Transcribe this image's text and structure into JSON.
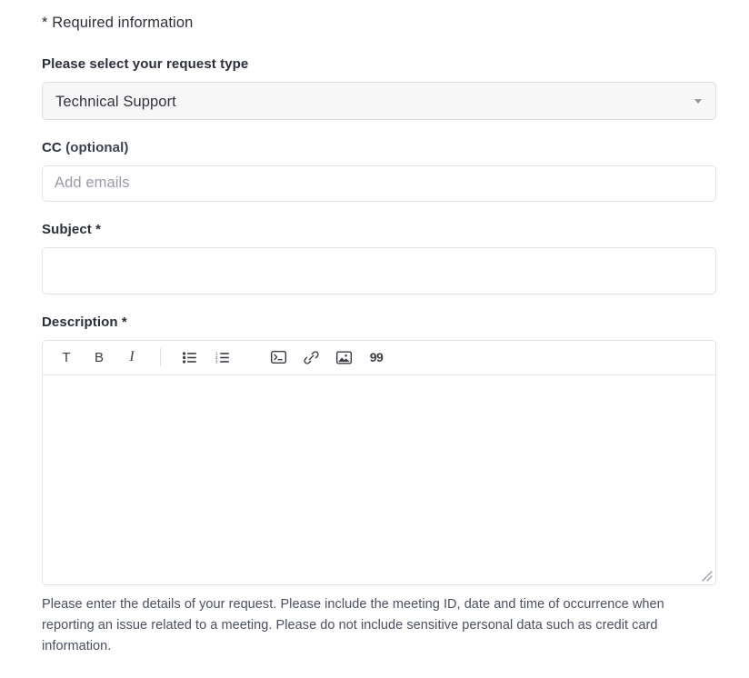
{
  "form": {
    "required_note": "* Required information",
    "request_type": {
      "label": "Please select your request type",
      "selected_value": "Technical Support",
      "caret_icon": "chevron-down-icon"
    },
    "cc": {
      "label_main": "CC ",
      "label_optional": "(optional)",
      "placeholder": "Add emails",
      "value": ""
    },
    "subject": {
      "label_main": "Subject ",
      "required_marker": "*",
      "placeholder": "",
      "value": ""
    },
    "description": {
      "label_main": "Description ",
      "required_marker": "*",
      "value": "",
      "placeholder": "",
      "helper_text": "Please enter the details of your request. Please include the meeting ID, date and time of occurrence when reporting an issue related to a meeting. Please do not include sensitive personal data such as credit card information.",
      "resize_handle_icon": "resize-grip-icon",
      "toolbar": [
        {
          "name": "text-style-button",
          "icon": "text-format-icon",
          "glyph": "T",
          "style": "plain"
        },
        {
          "name": "bold-button",
          "icon": "bold-icon",
          "glyph": "B",
          "style": "plain"
        },
        {
          "name": "italic-button",
          "icon": "italic-icon",
          "glyph": "I",
          "style": "italic"
        },
        {
          "name": "bulleted-list-button",
          "icon": "bulleted-list-icon",
          "glyph": "",
          "style": "svg-bullet-list"
        },
        {
          "name": "numbered-list-button",
          "icon": "numbered-list-icon",
          "glyph": "",
          "style": "svg-numbered-list"
        },
        {
          "name": "code-block-button",
          "icon": "code-block-icon",
          "glyph": "",
          "style": "svg-code"
        },
        {
          "name": "insert-link-button",
          "icon": "link-icon",
          "glyph": "",
          "style": "svg-link"
        },
        {
          "name": "insert-image-button",
          "icon": "image-icon",
          "glyph": "",
          "style": "svg-image"
        },
        {
          "name": "blockquote-button",
          "icon": "quote-icon",
          "glyph": "99",
          "style": "quote"
        }
      ]
    }
  },
  "colors": {
    "label": "#2b2e3b",
    "body_text": "#33343c",
    "helper_text": "#4b4f63",
    "border": "#e2e3e7",
    "select_bg": "#f7f7f8",
    "placeholder": "#9a9ba4"
  }
}
